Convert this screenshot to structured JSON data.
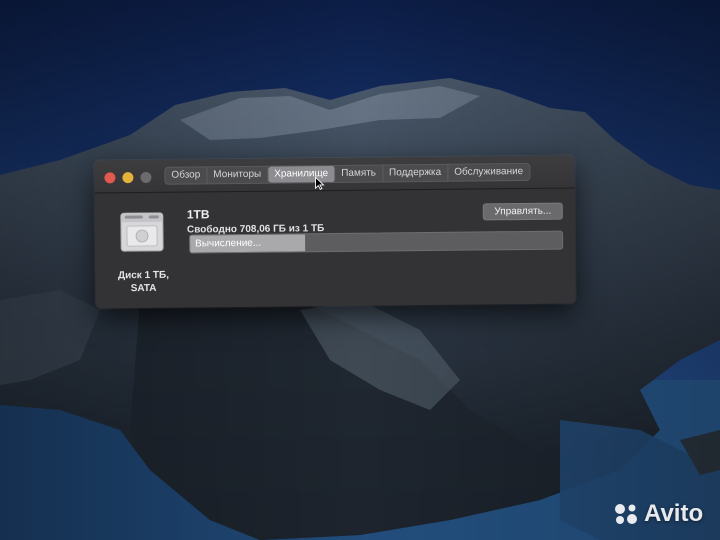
{
  "window": {
    "tabs": [
      {
        "label": "Обзор",
        "active": false
      },
      {
        "label": "Мониторы",
        "active": false
      },
      {
        "label": "Хранилище",
        "active": true
      },
      {
        "label": "Память",
        "active": false
      },
      {
        "label": "Поддержка",
        "active": false
      },
      {
        "label": "Обслуживание",
        "active": false
      }
    ]
  },
  "storage": {
    "disk_label": "Диск 1 ТБ, SATA",
    "volume_name": "1TB",
    "free_text": "Свободно 708,06 ГБ из 1 ТБ",
    "manage_label": "Управлять...",
    "progress_text": "Вычисление...",
    "progress_fraction": 0.31
  },
  "watermark": {
    "text": "Avito"
  },
  "colors": {
    "close": "#e2594f",
    "minimize": "#e3b23b",
    "zoom": "#6b6a6c",
    "window_bg": "#333234"
  }
}
